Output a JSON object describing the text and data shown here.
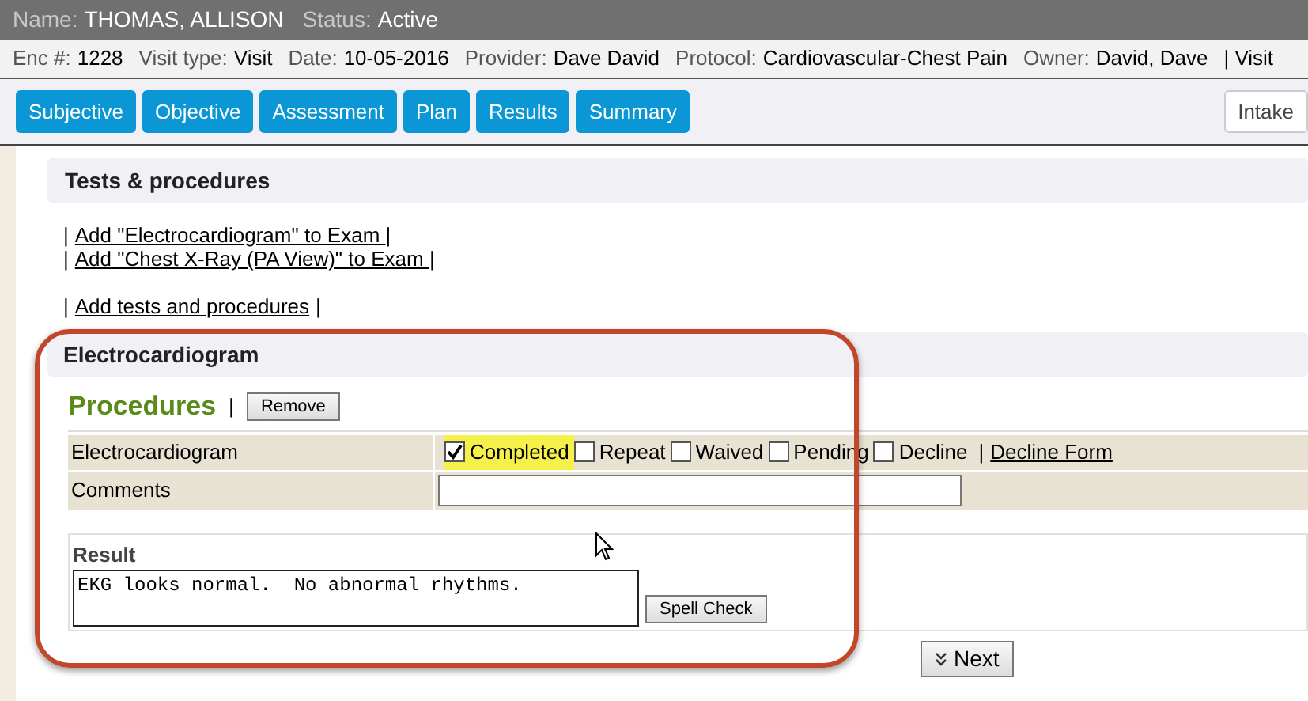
{
  "patient": [
    {
      "label": "Name:",
      "value": "THOMAS, ALLISON"
    },
    {
      "label": "Status:",
      "value": "Active"
    }
  ],
  "encounter": [
    {
      "label": "Enc #:",
      "value": "1228"
    },
    {
      "label": "Visit type:",
      "value": "Visit"
    },
    {
      "label": "Date:",
      "value": "10-05-2016"
    },
    {
      "label": "Provider:",
      "value": "Dave David"
    },
    {
      "label": "Protocol:",
      "value": "Cardiovascular-Chest Pain"
    },
    {
      "label": "Owner:",
      "value": "David, Dave"
    }
  ],
  "encounter_tail": "| Visit",
  "tabs": [
    {
      "label": "Subjective"
    },
    {
      "label": "Objective"
    },
    {
      "label": "Assessment"
    },
    {
      "label": "Plan"
    },
    {
      "label": "Results"
    },
    {
      "label": "Summary"
    }
  ],
  "intake_button": "Intake",
  "tests_section": {
    "title": "Tests & procedures",
    "links": [
      {
        "text": "Add \"Electrocardiogram\" to Exam "
      },
      {
        "text": "Add \"Chest X-Ray (PA View)\" to Exam "
      }
    ],
    "add_link": "Add tests and procedures",
    "separator": "|"
  },
  "procedure": {
    "title": "Electrocardiogram",
    "heading": "Procedures",
    "separator": "|",
    "remove_button": "Remove",
    "row_label": "Electrocardiogram",
    "options": [
      {
        "label": "Completed",
        "checked": true,
        "highlighted": true
      },
      {
        "label": "Repeat",
        "checked": false,
        "highlighted": false
      },
      {
        "label": "Waived",
        "checked": false,
        "highlighted": false
      },
      {
        "label": "Pending",
        "checked": false,
        "highlighted": false
      },
      {
        "label": "Decline",
        "checked": false,
        "highlighted": false
      }
    ],
    "decline_form_link": "Decline Form",
    "comments_label": "Comments",
    "result_label": "Result",
    "result_value": "EKG looks normal.  No abnormal rhythms.",
    "spell_check_button": "Spell Check"
  },
  "next_button": "Next"
}
